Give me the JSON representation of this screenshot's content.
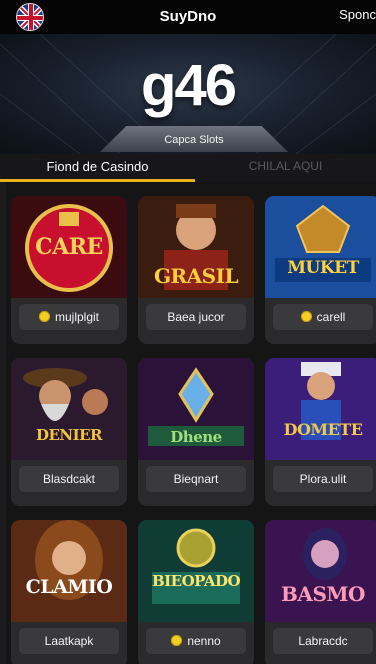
{
  "header": {
    "brand": "SuyDno",
    "right_link": "Sponc",
    "flag_icon": "uk-flag-icon"
  },
  "hero": {
    "number": "g46",
    "caption": "Capca Slots"
  },
  "tabs": [
    {
      "label": "Fiond de Casindo",
      "active": true
    },
    {
      "label": "CHILAL AQUI",
      "active": false
    }
  ],
  "games": [
    {
      "art_title": "CARE",
      "label": "mujlplgit",
      "coin": true,
      "accent": "#c8102e"
    },
    {
      "art_title": "GRASIL",
      "label": "Baea jucor",
      "coin": false,
      "accent": "#d6342a"
    },
    {
      "art_title": "MUKET",
      "label": "carell",
      "coin": true,
      "accent": "#2a6fd0"
    },
    {
      "art_title": "DENIER",
      "label": "Blasdcakt",
      "coin": false,
      "accent": "#6a2c8f"
    },
    {
      "art_title": "Dhene",
      "label": "Bieqnart",
      "coin": false,
      "accent": "#4b1f6b"
    },
    {
      "art_title": "DOMETE",
      "label": "Plora.ulit",
      "coin": false,
      "accent": "#3b1d7a"
    },
    {
      "art_title": "CLAMIO",
      "label": "Laatkapk",
      "coin": false,
      "accent": "#b8481c"
    },
    {
      "art_title": "BIEOPADO",
      "label": "nenno",
      "coin": true,
      "accent": "#1a6b5a"
    },
    {
      "art_title": "BASMO",
      "label": "Labracdc",
      "coin": false,
      "accent": "#7a2a8a"
    }
  ]
}
